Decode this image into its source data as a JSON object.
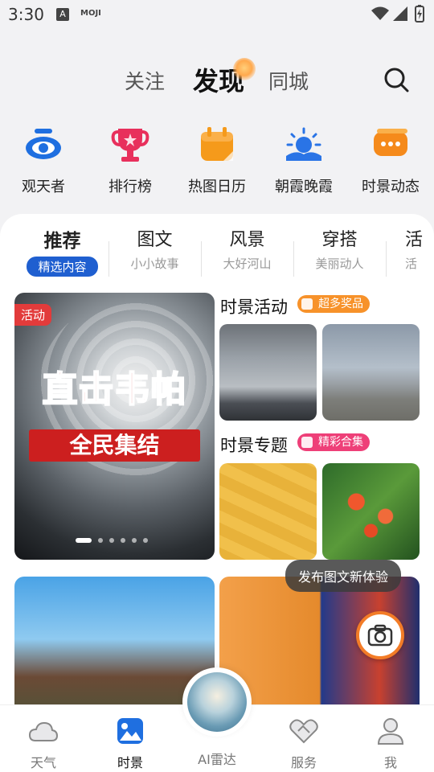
{
  "status_bar": {
    "time": "3:30",
    "app_icon_a": "A",
    "app_icon_moji": "MOJI"
  },
  "top_tabs": [
    "关注",
    "发现",
    "同城"
  ],
  "active_top_tab": "发现",
  "categories": [
    {
      "label": "观天者",
      "icon": "eye-icon",
      "color": "#1f6fe0"
    },
    {
      "label": "排行榜",
      "icon": "trophy-icon",
      "color": "#e8305c"
    },
    {
      "label": "热图日历",
      "icon": "calendar-icon",
      "color": "#f59a1b"
    },
    {
      "label": "朝霞晚霞",
      "icon": "sunrise-icon",
      "color": "#2a74e6"
    },
    {
      "label": "时景动态",
      "icon": "chat-bubble-icon",
      "color": "#f58a1b"
    }
  ],
  "sub_tabs": [
    {
      "title": "推荐",
      "subtitle": "精选内容"
    },
    {
      "title": "图文",
      "subtitle": "小小故事"
    },
    {
      "title": "风景",
      "subtitle": "大好河山"
    },
    {
      "title": "穿搭",
      "subtitle": "美丽动人"
    },
    {
      "title": "活",
      "subtitle": "活"
    }
  ],
  "banner": {
    "tag": "活动",
    "headline": "直击韦帕",
    "subheadline": "全民集结",
    "slide_count": 6,
    "active_slide": 1
  },
  "section_activity": {
    "title": "时景活动",
    "badge": "超多奖品",
    "badge_color": "#f7922a"
  },
  "section_topic": {
    "title": "时景专题",
    "badge": "精彩合集",
    "badge_color": "#ee3f78"
  },
  "publish_tip": "发布图文新体验",
  "bottom_nav": [
    {
      "label": "天气",
      "icon": "cloud-icon"
    },
    {
      "label": "时景",
      "icon": "photo-icon"
    },
    {
      "label": "AI雷达",
      "icon": "radar-icon"
    },
    {
      "label": "服务",
      "icon": "handshake-icon"
    },
    {
      "label": "我",
      "icon": "user-icon"
    }
  ],
  "active_nav": "时景"
}
